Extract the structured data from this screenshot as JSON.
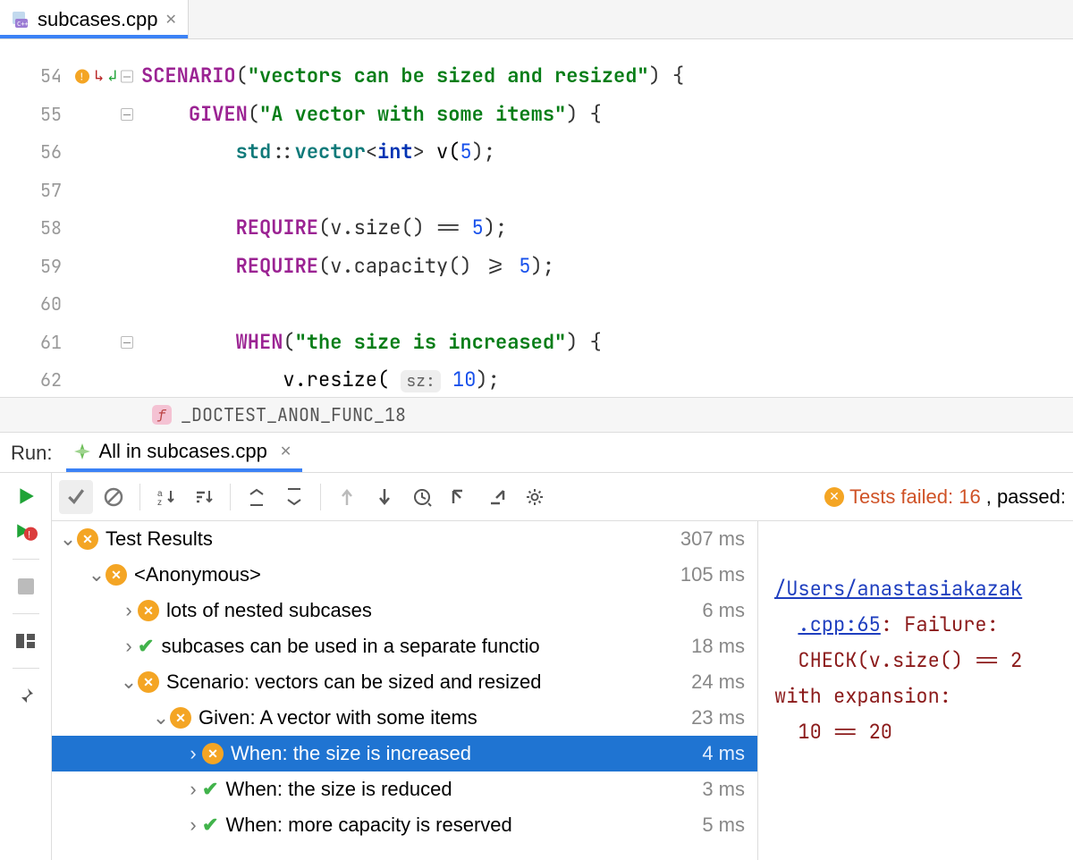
{
  "tab": {
    "filename": "subcases.cpp"
  },
  "editor": {
    "lines": [
      {
        "n": 54
      },
      {
        "n": 55
      },
      {
        "n": 56
      },
      {
        "n": 57
      },
      {
        "n": 58
      },
      {
        "n": 59
      },
      {
        "n": 60
      },
      {
        "n": 61
      },
      {
        "n": 62
      }
    ],
    "code": {
      "l54": {
        "macro": "SCENARIO",
        "str": "\"vectors can be sized and resized\"",
        "tail": ") {"
      },
      "l55": {
        "macro": "GIVEN",
        "str": "\"A vector with some items\"",
        "tail": ") {"
      },
      "l56": {
        "ns": "std",
        "vec": "vector",
        "kw": "int",
        "var": " v(",
        "num": "5",
        "end": ");"
      },
      "l58": {
        "macro": "REQUIRE",
        "inner": "(v.size() == ",
        "num": "5",
        "end": ");"
      },
      "l59": {
        "macro": "REQUIRE",
        "inner": "(v.capacity() >= ",
        "num": "5",
        "end": ");"
      },
      "l61": {
        "macro": "WHEN",
        "str": "\"the size is increased\"",
        "tail": ") {"
      },
      "l62": {
        "call": "            v.resize( ",
        "hint": "sz:",
        "num": "10",
        "end": ");"
      }
    }
  },
  "breadcrumb": {
    "kind": "f",
    "name": "_DOCTEST_ANON_FUNC_18"
  },
  "run": {
    "label": "Run:",
    "tab": "All in subcases.cpp",
    "status_fail": "Tests failed: 16",
    "status_pass": ", passed:"
  },
  "tree": [
    {
      "depth": 1,
      "chev": "v",
      "status": "fail",
      "label": "Test Results",
      "time": "307 ms"
    },
    {
      "depth": 2,
      "chev": "v",
      "status": "fail",
      "label": "<Anonymous>",
      "time": "105 ms"
    },
    {
      "depth": 3,
      "chev": ">",
      "status": "fail",
      "label": "lots of nested subcases",
      "time": "6 ms"
    },
    {
      "depth": 3,
      "chev": ">",
      "status": "pass",
      "label": "subcases can be used in a separate functio",
      "time": "18 ms"
    },
    {
      "depth": 3,
      "chev": "v",
      "status": "fail",
      "label": "Scenario: vectors can be sized and resized",
      "time": "24 ms"
    },
    {
      "depth": 4,
      "chev": "v",
      "status": "fail",
      "label": "Given: A vector with some items",
      "time": "23 ms"
    },
    {
      "depth": 5,
      "chev": ">",
      "status": "fail",
      "label": "When: the size is increased",
      "time": "4 ms",
      "sel": true
    },
    {
      "depth": 5,
      "chev": ">",
      "status": "pass",
      "label": "When: the size is reduced",
      "time": "3 ms"
    },
    {
      "depth": 5,
      "chev": ">",
      "status": "pass",
      "label": "When: more capacity is reserved",
      "time": "5 ms"
    }
  ],
  "detail": {
    "link": "/Users/anastasiakazak",
    "loc": ".cpp:65",
    "fail": ": Failure:",
    "check": "CHECK(v.size() == 2",
    "exp_label": "with expansion:",
    "exp_val": "10 == 20"
  }
}
